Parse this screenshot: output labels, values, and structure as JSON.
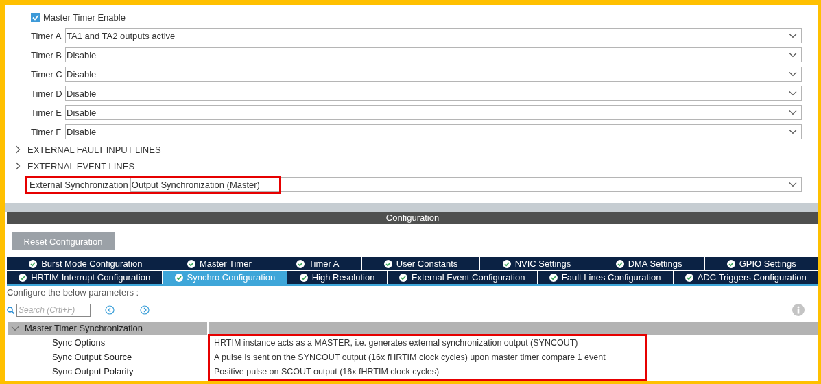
{
  "master_timer_enable": {
    "label": "Master Timer Enable",
    "checked": true
  },
  "timers": [
    {
      "label": "Timer A",
      "value": "TA1 and TA2 outputs active"
    },
    {
      "label": "Timer B",
      "value": "Disable"
    },
    {
      "label": "Timer C",
      "value": "Disable"
    },
    {
      "label": "Timer D",
      "value": "Disable"
    },
    {
      "label": "Timer E",
      "value": "Disable"
    },
    {
      "label": "Timer F",
      "value": "Disable"
    }
  ],
  "sections": [
    {
      "label": "EXTERNAL FAULT INPUT LINES",
      "expanded": false
    },
    {
      "label": "EXTERNAL EVENT LINES",
      "expanded": false
    }
  ],
  "external_sync": {
    "label": "External Synchronization",
    "value": "Output Synchronization (Master)",
    "highlighted": true
  },
  "configuration": {
    "title": "Configuration",
    "reset_button": "Reset Configuration",
    "tab_rows": [
      [
        {
          "label": "Burst Mode Configuration",
          "selected": false,
          "valid": true
        },
        {
          "label": "Master Timer",
          "selected": false,
          "valid": true
        },
        {
          "label": "Timer A",
          "selected": false,
          "valid": true
        },
        {
          "label": "User Constants",
          "selected": false,
          "valid": true
        },
        {
          "label": "NVIC Settings",
          "selected": false,
          "valid": true
        },
        {
          "label": "DMA Settings",
          "selected": false,
          "valid": true
        },
        {
          "label": "GPIO Settings",
          "selected": false,
          "valid": true
        }
      ],
      [
        {
          "label": "HRTIM Interrupt Configuration",
          "selected": false,
          "valid": true
        },
        {
          "label": "Synchro Configuration",
          "selected": true,
          "valid": true
        },
        {
          "label": "High Resolution",
          "selected": false,
          "valid": true
        },
        {
          "label": "External Event Configuration",
          "selected": false,
          "valid": true
        },
        {
          "label": "Fault Lines Configuration",
          "selected": false,
          "valid": true
        },
        {
          "label": "ADC Triggers Configuration",
          "selected": false,
          "valid": true
        }
      ]
    ],
    "hint": "Configure the below parameters :",
    "search": {
      "placeholder": "Search (Crtl+F)"
    },
    "group": {
      "label": "Master Timer Synchronization",
      "expanded": true,
      "values_highlighted": true,
      "params": [
        {
          "name": "Sync Options",
          "value": "HRTIM instance acts as a MASTER, i.e. generates external synchronization output (SYNCOUT)"
        },
        {
          "name": "Sync Output Source",
          "value": "A pulse is sent on the SYNCOUT output (16x fHRTIM clock cycles) upon master timer compare 1 event"
        },
        {
          "name": "Sync Output Polarity",
          "value": "Positive pulse on SCOUT output (16x fHRTIM clock cycles)"
        }
      ]
    }
  }
}
